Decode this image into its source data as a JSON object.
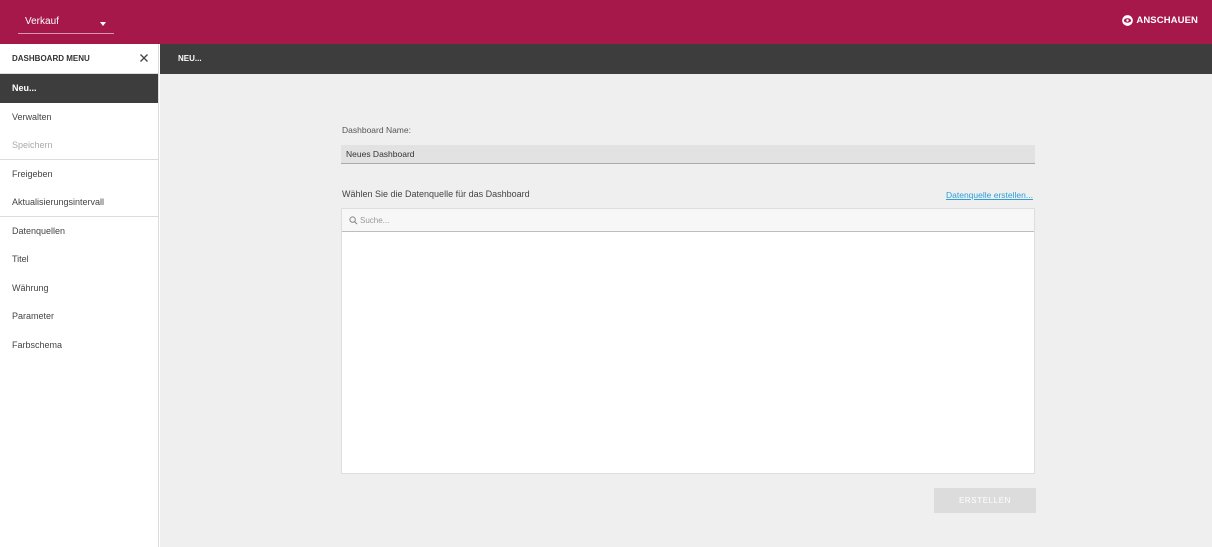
{
  "header": {
    "dashboard_select": "Verkauf",
    "view_button": "ANSCHAUEN",
    "brand_color": "#a6174a"
  },
  "sidebar": {
    "title": "DASHBOARD MENU",
    "items": [
      {
        "label": "Neu...",
        "state": "active"
      },
      {
        "label": "Verwalten",
        "state": "normal"
      },
      {
        "label": "Speichern",
        "state": "disabled"
      },
      {
        "label": "Freigeben",
        "state": "normal"
      },
      {
        "label": "Aktualisierungsintervall",
        "state": "normal"
      },
      {
        "label": "Datenquellen",
        "state": "normal"
      },
      {
        "label": "Titel",
        "state": "normal"
      },
      {
        "label": "Währung",
        "state": "normal"
      },
      {
        "label": "Parameter",
        "state": "normal"
      },
      {
        "label": "Farbschema",
        "state": "normal"
      }
    ]
  },
  "main": {
    "breadcrumb": "NEU...",
    "name_label": "Dashboard Name:",
    "name_value": "Neues Dashboard",
    "source_label": "Wählen Sie die Datenquelle für das Dashboard",
    "create_source_link": "Datenquelle erstellen...",
    "search_placeholder": "Suche...",
    "create_button": "ERSTELLEN"
  },
  "icons": {
    "view": "eye-icon",
    "close": "close-icon",
    "search": "search-icon",
    "dropdown": "chevron-down-icon"
  }
}
